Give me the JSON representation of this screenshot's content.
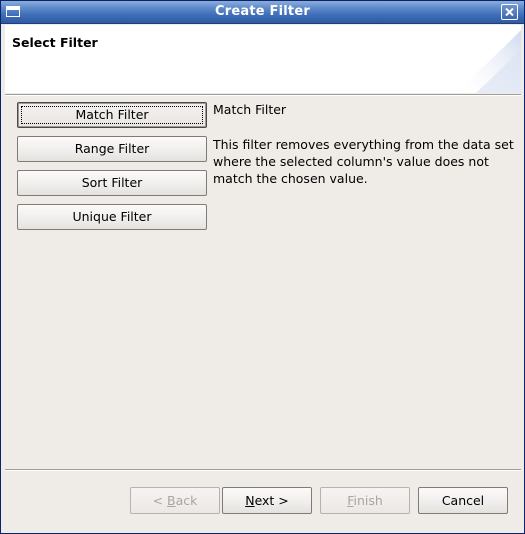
{
  "window": {
    "title": "Create Filter"
  },
  "header": {
    "title": "Select Filter"
  },
  "filters": [
    {
      "label": "Match Filter",
      "selected": true
    },
    {
      "label": "Range Filter",
      "selected": false
    },
    {
      "label": "Sort Filter",
      "selected": false
    },
    {
      "label": "Unique Filter",
      "selected": false
    }
  ],
  "description": {
    "title": "Match Filter",
    "text": "This filter removes everything from the data set where the selected column's value does not match the chosen value."
  },
  "footer": {
    "back": {
      "prefix": "< ",
      "mnemonic": "B",
      "rest": "ack",
      "enabled": false
    },
    "next": {
      "mnemonic": "N",
      "rest": "ext >",
      "enabled": true
    },
    "finish": {
      "mnemonic": "F",
      "rest": "inish",
      "enabled": false
    },
    "cancel": {
      "label": "Cancel",
      "enabled": true
    }
  },
  "colors": {
    "titlebar": "#3e6cb6",
    "dialog_bg": "#efebe7",
    "disabled_text": "#a9a5a1"
  },
  "icons": {
    "window": "window-icon",
    "close": "close-icon"
  }
}
